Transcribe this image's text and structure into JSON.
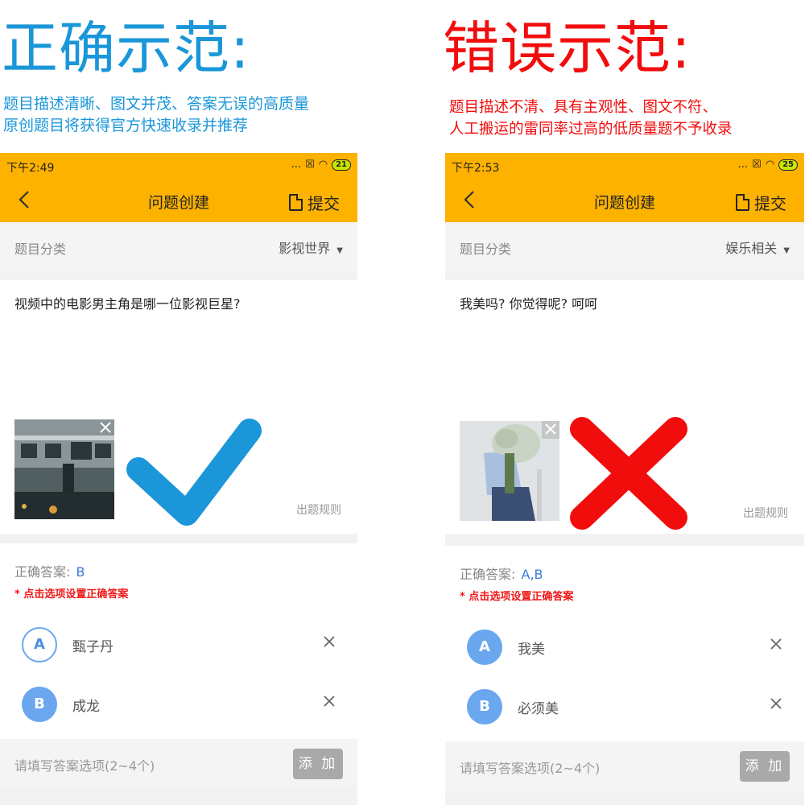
{
  "good": {
    "heading": "正确示范:",
    "desc": [
      "题目描述清晰、图文并茂、答案无误的高质量",
      "原创题目将获得官方快速收录并推荐"
    ],
    "status": {
      "time": "下午2:49",
      "dots": "...",
      "battery": "21"
    },
    "app_title": "问题创建",
    "submit_label": "提交",
    "category_label": "题目分类",
    "category_value": "影视世界",
    "question": "视频中的电影男主角是哪一位影视巨星?",
    "rules_label": "出题规则",
    "answer_label": "正确答案:",
    "answer_value": "B",
    "answer_hint": "* 点击选项设置正确答案",
    "options": [
      {
        "letter": "A",
        "text": "甄子丹",
        "style": "outline"
      },
      {
        "letter": "B",
        "text": "成龙",
        "style": "filled"
      }
    ],
    "add_placeholder": "请填写答案选项(2~4个)",
    "add_label": "添 加",
    "mark_color": "#1a96d9"
  },
  "bad": {
    "heading": "错误示范:",
    "desc": [
      "题目描述不清、具有主观性、图文不符、",
      "人工搬运的雷同率过高的低质量题不予收录"
    ],
    "status": {
      "time": "下午2:53",
      "dots": "...",
      "battery": "25"
    },
    "app_title": "问题创建",
    "submit_label": "提交",
    "category_label": "题目分类",
    "category_value": "娱乐相关",
    "question": "我美吗? 你觉得呢? 呵呵",
    "rules_label": "出题规则",
    "answer_label": "正确答案:",
    "answer_value": "A,B",
    "answer_hint": "* 点击选项设置正确答案",
    "options": [
      {
        "letter": "A",
        "text": "我美",
        "style": "filled"
      },
      {
        "letter": "B",
        "text": "必须美",
        "style": "filled"
      }
    ],
    "add_placeholder": "请填写答案选项(2~4个)",
    "add_label": "添 加",
    "mark_color": "#f20d0d"
  },
  "colors": {
    "appbar": "#fdb200",
    "accent_blue": "#1a96d9",
    "accent_red": "#f20d0d",
    "option_blue": "#6aa7ef"
  }
}
